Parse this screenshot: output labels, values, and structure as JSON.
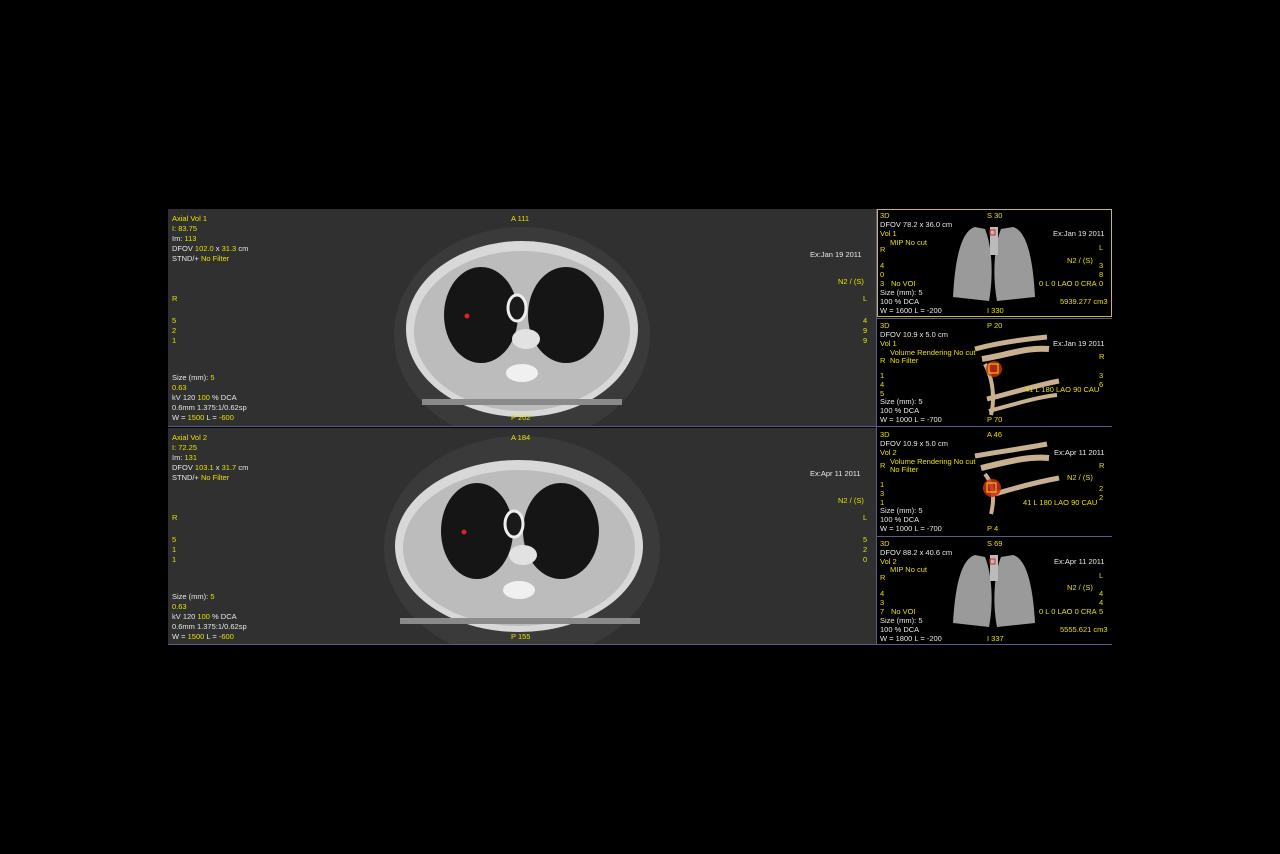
{
  "axial": [
    {
      "title": "Axial Vol 1",
      "i": "I: 83.75",
      "im_label": "Im: ",
      "im_value": "113",
      "dfov_label": "DFOV ",
      "dfov_a": "102.0",
      "dfov_x": " x ",
      "dfov_b": "31.3",
      "dfov_unit": " cm",
      "stnd": "STND/+ ",
      "filter": "No Filter",
      "top_marker": "A 111",
      "bottom_marker": "P 202",
      "exam_date": "Ex:Jan 19 2011",
      "n2": "N2 / (S)",
      "r": "R",
      "l": "L",
      "left_nums": [
        "5",
        "2",
        "1"
      ],
      "right_nums": [
        "4",
        "9",
        "9"
      ],
      "size_label": "Size  (mm): ",
      "size_value": "5",
      "size_sub": "0.63",
      "kv_a": "kV 120 ",
      "kv_b": "100",
      "kv_c": " % DCA",
      "slice": "0.6mm 1.375:1/0.62sp",
      "w_a": "W = ",
      "w_b": "1500",
      "w_c": " L = ",
      "w_d": "-600"
    },
    {
      "title": "Axial Vol 2",
      "i": "I: 72.25",
      "im_label": "Im: ",
      "im_value": "131",
      "dfov_label": "DFOV ",
      "dfov_a": "103.1",
      "dfov_x": " x ",
      "dfov_b": "31.7",
      "dfov_unit": " cm",
      "stnd": "STND/+ ",
      "filter": "No Filter",
      "top_marker": "A 184",
      "bottom_marker": "P 155",
      "exam_date": "Ex:Apr 11 2011",
      "n2": "N2 / (S)",
      "r": "R",
      "l": "L",
      "left_nums": [
        "5",
        "1",
        "1"
      ],
      "right_nums": [
        "5",
        "2",
        "0"
      ],
      "size_label": "Size  (mm): ",
      "size_value": "5",
      "size_sub": "0.63",
      "kv_a": "kV 120 ",
      "kv_b": "100",
      "kv_c": " % DCA",
      "slice": "0.6mm 1.375:1/0.62sp",
      "w_a": "W = ",
      "w_b": "1500",
      "w_c": " L = ",
      "w_d": "-600"
    }
  ],
  "threed": [
    {
      "kind": "3D",
      "dfov": "DFOV 78.2 x 36.0 cm",
      "vol": "Vol 1",
      "mode": "MIP No cut",
      "filter": "",
      "top_marker": "S 30",
      "bottom_marker": "I 330",
      "exam_date": "Ex:Jan 19 2011",
      "n2": "N2 / (S)",
      "r": "R",
      "l": "L",
      "left_nums": [
        "4",
        "0",
        "3"
      ],
      "right_nums": [
        "3",
        "8",
        "0"
      ],
      "voi": "No VOI",
      "orientation": "0 L 0 LAO 0 CRA",
      "volume": "5939.277 cm3",
      "size": "Size  (mm): 5",
      "dca": "100 % DCA",
      "wl": "W = 1600 L = -200"
    },
    {
      "kind": "3D",
      "dfov": "DFOV 10.9 x 5.0 cm",
      "vol": "Vol 1",
      "mode": "Volume Rendering No cut",
      "filter": "No Filter",
      "top_marker": "P 20",
      "bottom_marker": "P 70",
      "exam_date": "Ex:Jan 19 2011",
      "n2": "",
      "r": "R",
      "l": "R",
      "left_nums": [
        "1",
        "4",
        "5"
      ],
      "right_nums": [
        "3",
        "6",
        ""
      ],
      "voi": "",
      "orientation": "41 L 180 LAO 90 CAU",
      "volume": "",
      "size": "Size  (mm): 5",
      "dca": "100 % DCA",
      "wl": "W = 1000 L = -700"
    },
    {
      "kind": "3D",
      "dfov": "DFOV 10.9 x 5.0 cm",
      "vol": "Vol 2",
      "mode": "Volume Rendering No cut",
      "filter": "No Filter",
      "top_marker": "A 46",
      "bottom_marker": "P 4",
      "exam_date": "Ex:Apr 11 2011",
      "n2": "N2 / (S)",
      "r": "R",
      "l": "R",
      "left_nums": [
        "1",
        "3",
        "1"
      ],
      "right_nums": [
        "2",
        "2",
        ""
      ],
      "voi": "",
      "orientation": "41 L 180 LAO 90 CAU",
      "volume": "",
      "size": "Size  (mm): 5",
      "dca": "100 % DCA",
      "wl": "W = 1000 L = -700"
    },
    {
      "kind": "3D",
      "dfov": "DFOV 88.2 x 40.6 cm",
      "vol": "Vol 2",
      "mode": "MIP No cut",
      "filter": "",
      "top_marker": "S 69",
      "bottom_marker": "I 337",
      "exam_date": "Ex:Apr 11 2011",
      "n2": "N2 / (S)",
      "r": "R",
      "l": "L",
      "left_nums": [
        "4",
        "3",
        "7"
      ],
      "right_nums": [
        "4",
        "4",
        "5"
      ],
      "voi": "No VOI",
      "orientation": "0 L 0 LAO 0 CRA",
      "volume": "5555.621 cm3",
      "size": "Size  (mm): 5",
      "dca": "100 % DCA",
      "wl": "W = 1800 L = -200"
    }
  ]
}
